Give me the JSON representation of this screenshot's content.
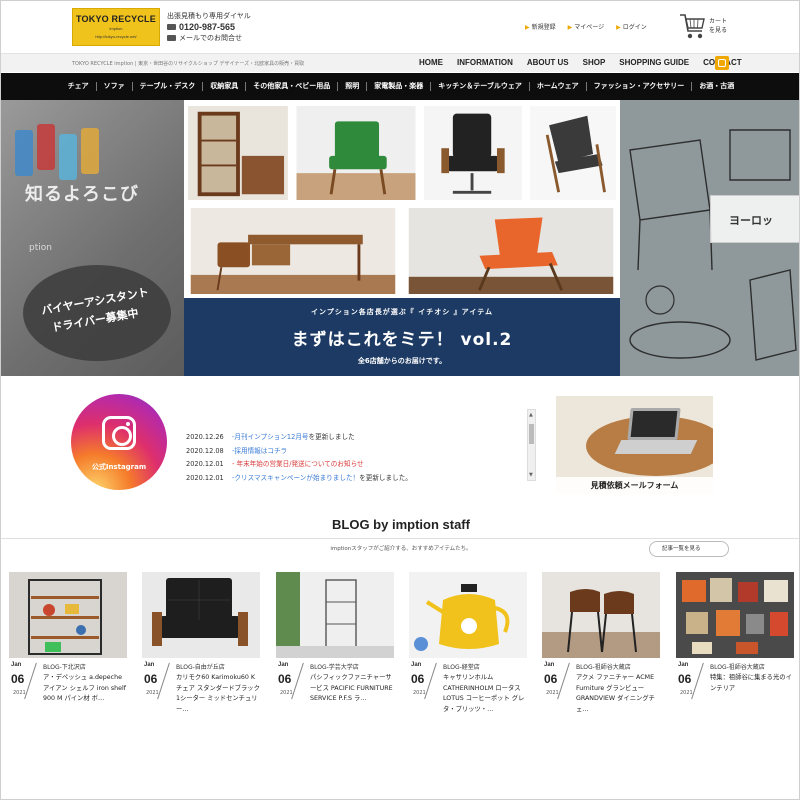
{
  "header": {
    "logo": {
      "line1": "TOKYO RECYCLE",
      "line2": "imption",
      "line3": "http://tokyo-recycle.net/"
    },
    "contact": {
      "label": "出張見積もり専用ダイヤル",
      "phone": "0120-987-565",
      "mail": "メールでのお問合せ"
    },
    "user_nav": [
      "新規登録",
      "マイページ",
      "ログイン"
    ],
    "cart": {
      "line1": "カート",
      "line2": "を見る"
    }
  },
  "subbar": {
    "tagline": "TOKYO RECYCLE imption | 東京・世田谷のリサイクルショップ デザイナーズ・北欧家具の販売・買取",
    "nav": [
      "HOME",
      "INFORMATION",
      "ABOUT US",
      "SHOP",
      "SHOPPING GUIDE",
      "CONTACT"
    ]
  },
  "categories": [
    "チェア",
    "ソファ",
    "テーブル・デスク",
    "収納家具",
    "その他家具・ベビー用品",
    "照明",
    "家電製品・楽器",
    "キッチン＆テーブルウェア",
    "ホームウェア",
    "ファッション・アクセサリー",
    "お酒・古酒"
  ],
  "hero": {
    "left_text": "知るよろこび",
    "left_sub": "ption",
    "hiring_line1": "バイヤーアシスタント",
    "hiring_line2": "ドライバー募集中",
    "banner_line1": "インプション各店長が選ぶ『 イチオシ 』アイテム",
    "banner_line2": "まずはこれをミテ！ vol.2",
    "banner_line3": "全6店舗からのお届けです。",
    "right_text": "ヨーロッ"
  },
  "instagram": {
    "caption": "公式Instagram"
  },
  "news": [
    {
      "date": "2020.12.26",
      "link": "-月刊インプション12月号",
      "rest": " を更新しました",
      "red": false
    },
    {
      "date": "2020.12.08",
      "link": "-採用情報はコチラ",
      "rest": "",
      "red": false
    },
    {
      "date": "2020.12.01",
      "link": "- 年末年始の営業日/発送についてのお知らせ",
      "rest": "",
      "red": true
    },
    {
      "date": "2020.12.01",
      "link": "-クリスマスキャンペーンが始まりました！",
      "rest": " を更新しました。",
      "red": false
    }
  ],
  "quote_banner": {
    "label": "見積依頼メールフォーム"
  },
  "blog": {
    "title": "BLOG by imption staff",
    "subtitle": "imptionスタッフがご紹介する、おすすめアイテムたち。",
    "more": "記事一覧を見る",
    "posts": [
      {
        "month": "Jan",
        "day": "06",
        "year": "2021",
        "shop": "BLOG-下北沢店",
        "title": "ア・デペッシュ a.depeche アイアン シェルフ iron shelf 900 M パイン材 ボ…"
      },
      {
        "month": "Jan",
        "day": "06",
        "year": "2021",
        "shop": "BLOG-自由が丘店",
        "title": "カリモク60 Karimoku60 K チェア スタンダードブラック 1シーター ミッドセンチュリー…"
      },
      {
        "month": "Jan",
        "day": "06",
        "year": "2021",
        "shop": "BLOG-学芸大学店",
        "title": "パシフィックファニチャーサービス PACIFIC FURNITURE SERVICE P.F.S ラ…"
      },
      {
        "month": "Jan",
        "day": "06",
        "year": "2021",
        "shop": "BLOG-経堂店",
        "title": "キャサリンホルム CATHERINHOLM ロータス LOTUS コーヒーポット グレタ・プリッツ・…"
      },
      {
        "month": "Jan",
        "day": "06",
        "year": "2021",
        "shop": "BLOG-祖師谷大蔵店",
        "title": "アクメ ファニチャー ACME Furniture グランビュー GRANDVIEW ダイニングチェ…"
      },
      {
        "month": "Jan",
        "day": "06",
        "year": "2021",
        "shop": "BLOG-祖師谷大蔵店",
        "title": "特集：祖師谷に集まる光のインテリア"
      }
    ]
  }
}
